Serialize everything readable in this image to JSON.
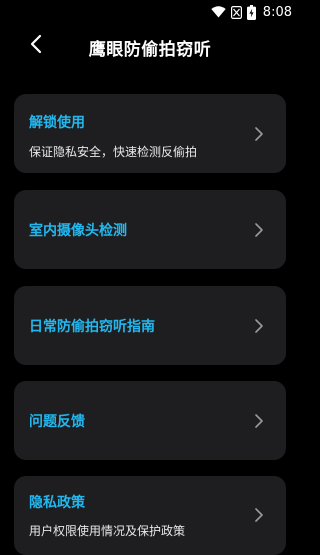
{
  "status_bar": {
    "time": "8:08",
    "icons": [
      "wifi-icon",
      "no-signal-icon",
      "battery-charging-icon"
    ]
  },
  "header": {
    "title": "鹰眼防偷拍窃听",
    "back_icon": "chevron-left-icon"
  },
  "theme": {
    "background": "#000000",
    "card_background": "#1e1e20",
    "accent": "#22b8ef",
    "chevron_color": "#9a9a9a"
  },
  "menu": [
    {
      "title": "解锁使用",
      "subtitle": "保证隐私安全，快速检测反偷拍",
      "icon": "chevron-right-icon"
    },
    {
      "title": "室内摄像头检测",
      "icon": "chevron-right-icon"
    },
    {
      "title": "日常防偷拍窃听指南",
      "icon": "chevron-right-icon"
    },
    {
      "title": "问题反馈",
      "icon": "chevron-right-icon"
    },
    {
      "title": "隐私政策",
      "subtitle": "用户权限使用情况及保护政策",
      "icon": "chevron-right-icon"
    }
  ]
}
